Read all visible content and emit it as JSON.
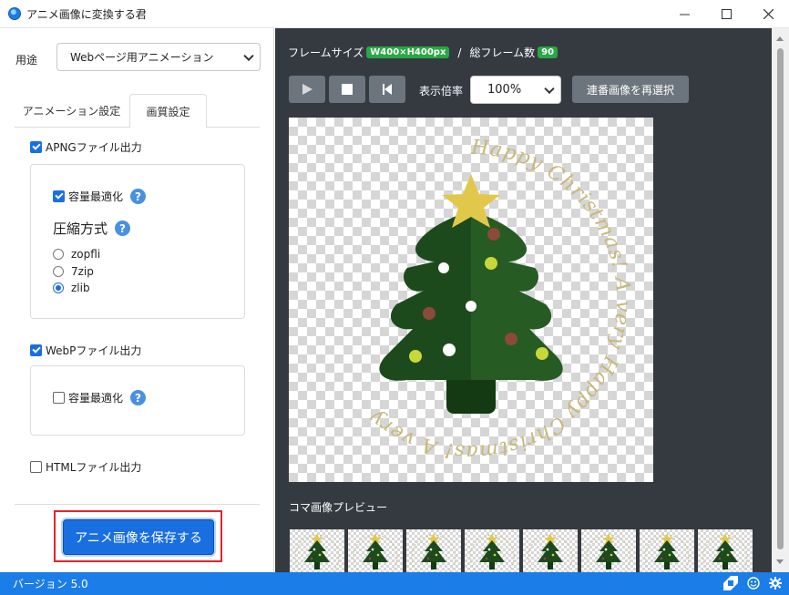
{
  "window": {
    "title": "アニメ画像に変換する君",
    "icon": "app-icon"
  },
  "left": {
    "purpose_label": "用途",
    "purpose_value": "Webページ用アニメーション",
    "tabs": [
      {
        "label": "アニメーション設定",
        "active": false
      },
      {
        "label": "画質設定",
        "active": true
      }
    ],
    "apng": {
      "label": "APNGファイル出力",
      "checked": true,
      "optimize_label": "容量最適化",
      "optimize_checked": true,
      "compression_title": "圧縮方式",
      "options": [
        {
          "label": "zopfli",
          "selected": false
        },
        {
          "label": "7zip",
          "selected": false
        },
        {
          "label": "zlib",
          "selected": true
        }
      ]
    },
    "webp": {
      "label": "WebPファイル出力",
      "checked": true,
      "optimize_label": "容量最適化",
      "optimize_checked": false
    },
    "html": {
      "label": "HTMLファイル出力",
      "checked": false
    },
    "save_button": "アニメ画像を保存する",
    "help_glyph": "?"
  },
  "right": {
    "frame_size_label": "フレームサイズ",
    "frame_size_value": "W400×H400px",
    "separator": "/",
    "frame_count_label": "総フレーム数",
    "frame_count_value": "90",
    "zoom_label": "表示倍率",
    "zoom_value": "100%",
    "reselect_button": "連番画像を再選択",
    "frames_label": "コマ画像プレビュー",
    "preview_text": "Happy Christmas! A very Happy Christmas! A very",
    "thumbnail_count": 8
  },
  "status": {
    "version": "バージョン 5.0"
  },
  "colors": {
    "accent": "#1a7de8",
    "panel_dark": "#343a40",
    "tree_dark": "#1d4a1d",
    "star": "#e2c84a",
    "gold_text": "#c9b77b",
    "highlight_border": "#e5232b"
  }
}
